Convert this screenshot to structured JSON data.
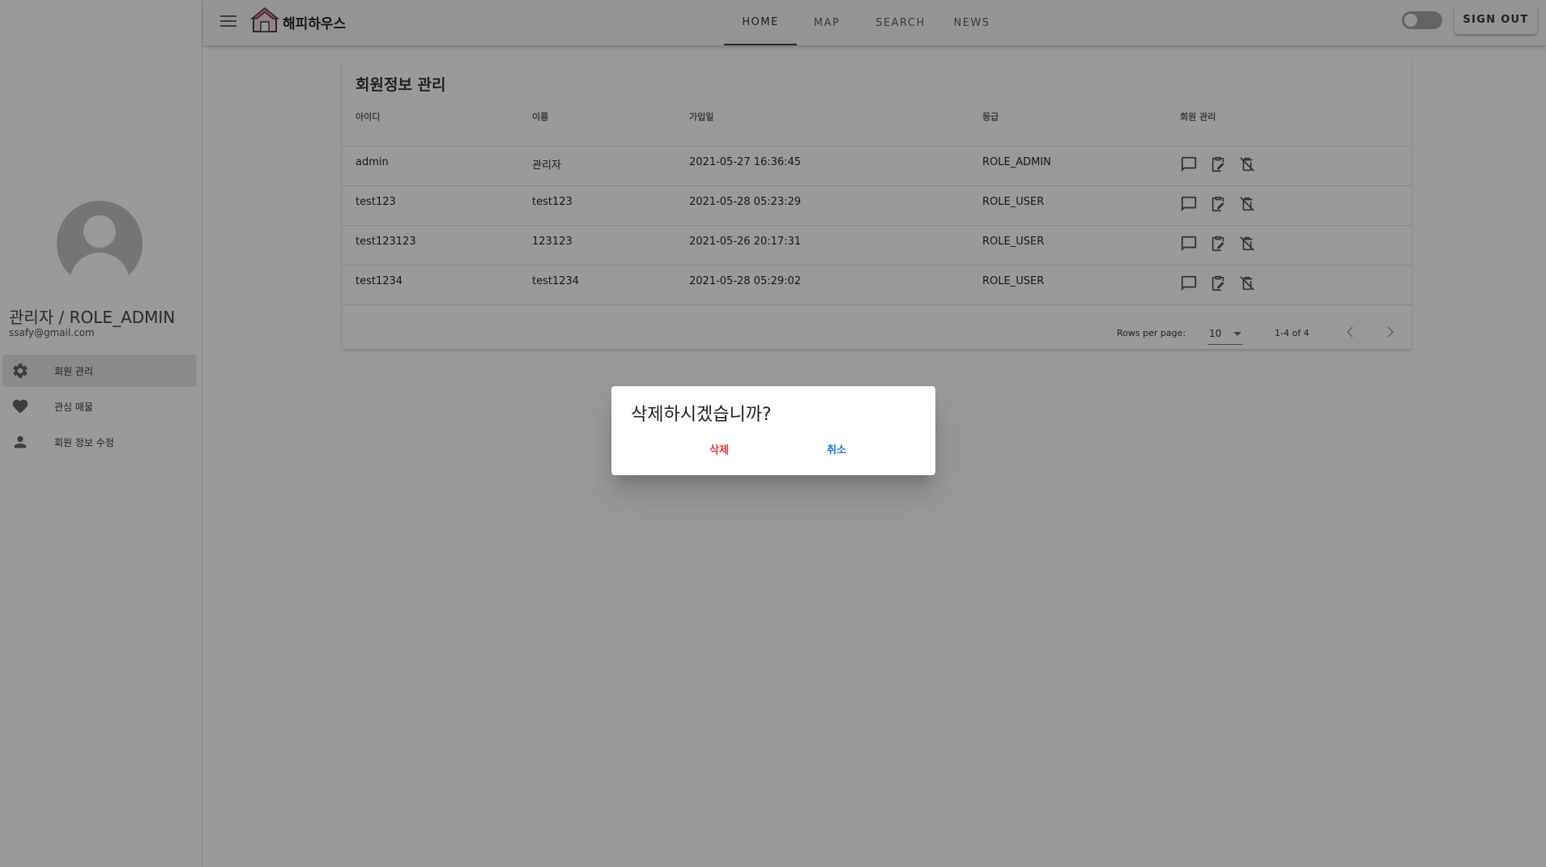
{
  "app": {
    "logo_text": "해피하우스"
  },
  "header": {
    "tabs": [
      {
        "label": "HOME",
        "active": true
      },
      {
        "label": "MAP",
        "active": false
      },
      {
        "label": "SEARCH",
        "active": false
      },
      {
        "label": "NEWS",
        "active": false
      }
    ],
    "toggle_on": false,
    "signout_label": "SIGN OUT"
  },
  "sidebar": {
    "user_name": "관리자 / ROLE_ADMIN",
    "user_email": "ssafy@gmail.com",
    "items": [
      {
        "label": "회원 관리",
        "icon": "gear-icon",
        "active": true
      },
      {
        "label": "관심 매물",
        "icon": "heart-icon",
        "active": false
      },
      {
        "label": "회원 정보 수정",
        "icon": "person-icon",
        "active": false
      }
    ]
  },
  "main": {
    "card_title": "회원정보 관리",
    "columns": [
      "아이디",
      "이름",
      "가입일",
      "등급",
      "회원 관리"
    ],
    "rows": [
      {
        "id": "admin",
        "name": "관리자",
        "joined": "2021-05-27 16:36:45",
        "grade": "ROLE_ADMIN"
      },
      {
        "id": "test123",
        "name": "test123",
        "joined": "2021-05-28 05:23:29",
        "grade": "ROLE_USER"
      },
      {
        "id": "test123123",
        "name": "123123",
        "joined": "2021-05-26 20:17:31",
        "grade": "ROLE_USER"
      },
      {
        "id": "test1234",
        "name": "test1234",
        "joined": "2021-05-28 05:29:02",
        "grade": "ROLE_USER"
      }
    ],
    "pagination": {
      "rows_per_page_label": "Rows per page:",
      "rows_per_page_value": "10",
      "range": "1-4 of 4"
    }
  },
  "dialog": {
    "title": "삭제하시겠습니까?",
    "confirm_label": "삭제",
    "cancel_label": "취소",
    "confirm_color": "#e53935",
    "cancel_color": "#1976d2"
  }
}
